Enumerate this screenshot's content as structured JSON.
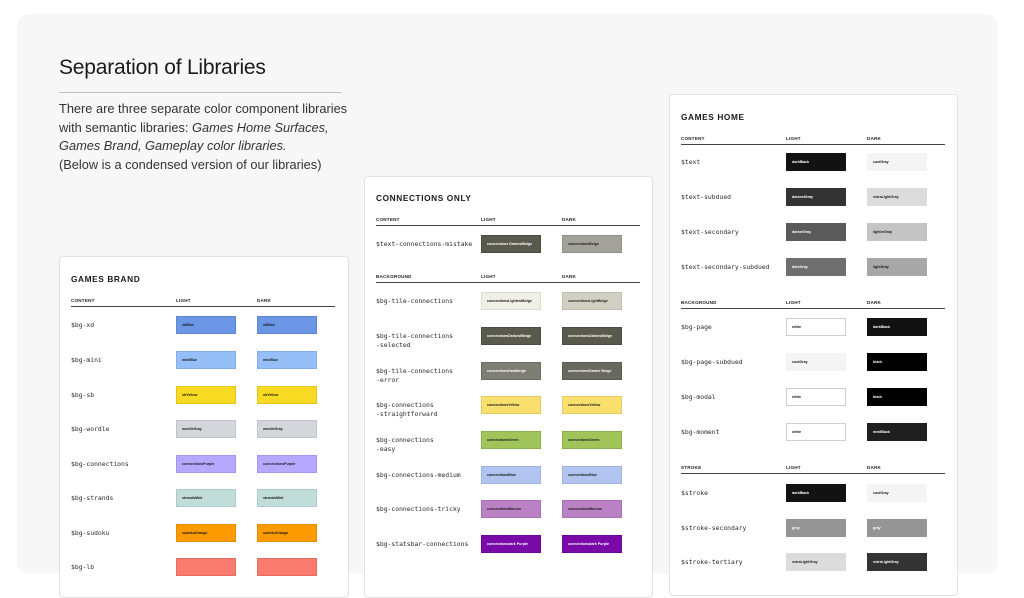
{
  "page": {
    "title": "Separation of Libraries",
    "intro": [
      {
        "segments": [
          {
            "text": "There are three separate color component libraries"
          }
        ]
      },
      {
        "segments": [
          {
            "text": "with semantic libraries: "
          },
          {
            "text": "Games Home Surfaces,",
            "italic": true
          }
        ]
      },
      {
        "segments": [
          {
            "text": "Games Brand, Gameplay color libraries.",
            "italic": true
          }
        ]
      },
      {
        "segments": [
          {
            "text": "(Below is a condensed version of our libraries)"
          }
        ]
      }
    ]
  },
  "cards": [
    {
      "key": "games-brand",
      "title": "GAMES BRAND",
      "sections": [
        {
          "headers": {
            "content": "CONTENT",
            "light": "LIGHT",
            "dark": "DARK"
          },
          "rows": [
            {
              "token": "$bg-xd",
              "light": {
                "label": "xdBlue",
                "bg": "#6b96e5",
                "fg": "#1a1a1a",
                "border": "#5f86d1"
              },
              "dark": {
                "label": "xdBlue",
                "bg": "#6b96e5",
                "fg": "#1a1a1a",
                "border": "#5f86d1"
              }
            },
            {
              "token": "$bg-mini",
              "light": {
                "label": "miniBlue",
                "bg": "#96bff8",
                "fg": "#1a1a1a",
                "border": "#86aee6"
              },
              "dark": {
                "label": "miniBlue",
                "bg": "#96bff8",
                "fg": "#1a1a1a",
                "border": "#86aee6"
              }
            },
            {
              "token": "$bg-sb",
              "light": {
                "label": "sbYellow",
                "bg": "#f7da21",
                "fg": "#1a1a1a",
                "border": "#e0c51c"
              },
              "dark": {
                "label": "sbYellow",
                "bg": "#f7da21",
                "fg": "#1a1a1a",
                "border": "#e0c51c"
              }
            },
            {
              "token": "$bg-wordle",
              "light": {
                "label": "wordleGray",
                "bg": "#d3d6da",
                "fg": "#1a1a1a",
                "border": "#c2c5c9"
              },
              "dark": {
                "label": "wordleGray",
                "bg": "#d3d6da",
                "fg": "#1a1a1a",
                "border": "#c2c5c9"
              }
            },
            {
              "token": "$bg-connections",
              "light": {
                "label": "connectionsPurple",
                "bg": "#b4a8ff",
                "fg": "#1a1a1a",
                "border": "#a397ec"
              },
              "dark": {
                "label": "connectionsPurple",
                "bg": "#b4a8ff",
                "fg": "#1a1a1a",
                "border": "#a397ec"
              }
            },
            {
              "token": "$bg-strands",
              "light": {
                "label": "strandsMint",
                "bg": "#c0ddd9",
                "fg": "#1a1a1a",
                "border": "#aecbc7"
              },
              "dark": {
                "label": "strandsMint",
                "bg": "#c0ddd9",
                "fg": "#1a1a1a",
                "border": "#aecbc7"
              }
            },
            {
              "token": "$bg-sudoku",
              "light": {
                "label": "sudokuOrange",
                "bg": "#fb9b00",
                "fg": "#1a1a1a",
                "border": "#e58d00"
              },
              "dark": {
                "label": "sudokuOrange",
                "bg": "#fb9b00",
                "fg": "#1a1a1a",
                "border": "#e58d00"
              }
            },
            {
              "token": "$bg-lb",
              "light": {
                "label": "",
                "bg": "#f97a6f",
                "fg": "#1a1a1a",
                "border": "#e76c62"
              },
              "dark": {
                "label": "",
                "bg": "#f97a6f",
                "fg": "#1a1a1a",
                "border": "#e76c62"
              }
            }
          ]
        }
      ]
    },
    {
      "key": "connections-only",
      "title": "CONNECTIONS ONLY",
      "sections": [
        {
          "headers": {
            "content": "CONTENT",
            "light": "LIGHT",
            "dark": "DARK"
          },
          "rows": [
            {
              "token": "$text-connections-mistake",
              "light": {
                "label": "connections DarkestBeige",
                "bg": "#5a594e",
                "fg": "#ffffff",
                "border": "#4d4c42"
              },
              "dark": {
                "label": "connectionsBeige",
                "bg": "#a3a29a",
                "fg": "#1a1a1a",
                "border": "#93928a"
              }
            }
          ]
        },
        {
          "headers": {
            "content": "BACKGROUND",
            "light": "LIGHT",
            "dark": "DARK"
          },
          "rows": [
            {
              "token": "$bg-tile-connections",
              "light": {
                "label": "connectionsLightestBeige",
                "bg": "#efefe6",
                "fg": "#1a1a1a",
                "border": "#dcdcd2"
              },
              "dark": {
                "label": "connectionsLightBeige",
                "bg": "#d1d0c3",
                "fg": "#1a1a1a",
                "border": "#c0bfb2"
              }
            },
            {
              "token": "$bg-tile-connections -selected",
              "light": {
                "label": "connectionsDarkestBeige",
                "bg": "#5a594e",
                "fg": "#ffffff",
                "border": "#4d4c42"
              },
              "dark": {
                "label": "connectionsDarkestBeige",
                "bg": "#5a594e",
                "fg": "#ffffff",
                "border": "#4d4c42"
              }
            },
            {
              "token": "$bg-tile-connections -error",
              "light": {
                "label": "connectionsDarkBeige",
                "bg": "#7f7e74",
                "fg": "#ffffff",
                "border": "#6f6e65"
              },
              "dark": {
                "label": "connectionsDarker Beige",
                "bg": "#6a6960",
                "fg": "#ffffff",
                "border": "#5c5b53"
              }
            },
            {
              "token": "$bg-connections -straightforward",
              "light": {
                "label": "connectionsYellow",
                "bg": "#f9df6d",
                "fg": "#1a1a1a",
                "border": "#e6cc5f"
              },
              "dark": {
                "label": "connectionsYellow",
                "bg": "#f9df6d",
                "fg": "#1a1a1a",
                "border": "#e6cc5f"
              }
            },
            {
              "token": "$bg-connections -easy",
              "light": {
                "label": "connectionsGreen",
                "bg": "#a0c35a",
                "fg": "#1a1a1a",
                "border": "#8fb14d"
              },
              "dark": {
                "label": "connectionsGreen",
                "bg": "#a0c35a",
                "fg": "#1a1a1a",
                "border": "#8fb14d"
              }
            },
            {
              "token": "$bg-connections-medium",
              "light": {
                "label": "connectionsBlue",
                "bg": "#b0c4ef",
                "fg": "#1a1a1a",
                "border": "#9fb3de"
              },
              "dark": {
                "label": "connectionsBlue",
                "bg": "#b0c4ef",
                "fg": "#1a1a1a",
                "border": "#9fb3de"
              }
            },
            {
              "token": "$bg-connections-tricky",
              "light": {
                "label": "connectionsMaroon",
                "bg": "#ba81c5",
                "fg": "#1a1a1a",
                "border": "#a972b4"
              },
              "dark": {
                "label": "connectionsMaroon",
                "bg": "#ba81c5",
                "fg": "#1a1a1a",
                "border": "#a972b4"
              }
            },
            {
              "token": "$bg-statsbar-connections",
              "light": {
                "label": "connectionsdark Purple",
                "bg": "#7a0aa8",
                "fg": "#ffffff",
                "border": "#6a0893"
              },
              "dark": {
                "label": "connectionsdark Purple",
                "bg": "#7a0aa8",
                "fg": "#ffffff",
                "border": "#6a0893"
              }
            }
          ]
        }
      ]
    },
    {
      "key": "games-home",
      "title": "GAMES HOME",
      "sections": [
        {
          "headers": {
            "content": "CONTENT",
            "light": "LIGHT",
            "dark": "DARK"
          },
          "rows": [
            {
              "token": "$text",
              "light": {
                "label": "darkBlack",
                "bg": "#121212",
                "fg": "#ffffff",
                "border": "#121212"
              },
              "dark": {
                "label": "coolGray",
                "bg": "#f4f4f4",
                "fg": "#1a1a1a",
                "border": "#f4f4f4"
              }
            },
            {
              "token": "$text-subdued",
              "light": {
                "label": "darkestGray",
                "bg": "#333333",
                "fg": "#ffffff",
                "border": "#333333"
              },
              "dark": {
                "label": "extraLightGray",
                "bg": "#dcdcdc",
                "fg": "#1a1a1a",
                "border": "#dcdcdc"
              }
            },
            {
              "token": "$text-secondary",
              "light": {
                "label": "darkerGray",
                "bg": "#5a5a5a",
                "fg": "#ffffff",
                "border": "#5a5a5a"
              },
              "dark": {
                "label": "lighterGray",
                "bg": "#c4c4c4",
                "fg": "#1a1a1a",
                "border": "#c4c4c4"
              }
            },
            {
              "token": "$text-secondary-subdued",
              "light": {
                "label": "darkGray",
                "bg": "#6f6f6f",
                "fg": "#ffffff",
                "border": "#6f6f6f"
              },
              "dark": {
                "label": "lightGray",
                "bg": "#a7a7a7",
                "fg": "#1a1a1a",
                "border": "#a7a7a7"
              }
            }
          ]
        },
        {
          "headers": {
            "content": "BACKGROUND",
            "light": "LIGHT",
            "dark": "DARK"
          },
          "rows": [
            {
              "token": "$bg-page",
              "light": {
                "label": "white",
                "bg": "#ffffff",
                "fg": "#1a1a1a",
                "border": "#cfcfcf"
              },
              "dark": {
                "label": "darkBlack",
                "bg": "#121212",
                "fg": "#ffffff",
                "border": "#121212"
              }
            },
            {
              "token": "$bg-page-subdued",
              "light": {
                "label": "coolGray",
                "bg": "#f4f4f4",
                "fg": "#1a1a1a",
                "border": "#f4f4f4"
              },
              "dark": {
                "label": "black",
                "bg": "#000000",
                "fg": "#ffffff",
                "border": "#000000"
              }
            },
            {
              "token": "$bg-modal",
              "light": {
                "label": "white",
                "bg": "#ffffff",
                "fg": "#1a1a1a",
                "border": "#cfcfcf"
              },
              "dark": {
                "label": "black",
                "bg": "#000000",
                "fg": "#ffffff",
                "border": "#000000"
              }
            },
            {
              "token": "$bg-moment",
              "light": {
                "label": "white",
                "bg": "#ffffff",
                "fg": "#1a1a1a",
                "border": "#cfcfcf"
              },
              "dark": {
                "label": "medBlack",
                "bg": "#1f1f1f",
                "fg": "#ffffff",
                "border": "#1f1f1f"
              }
            }
          ]
        },
        {
          "headers": {
            "content": "STROKE",
            "light": "LIGHT",
            "dark": "DARK"
          },
          "rows": [
            {
              "token": "$stroke",
              "light": {
                "label": "darkBlack",
                "bg": "#121212",
                "fg": "#ffffff",
                "border": "#121212"
              },
              "dark": {
                "label": "coolGray",
                "bg": "#f4f4f4",
                "fg": "#1a1a1a",
                "border": "#f4f4f4"
              }
            },
            {
              "token": "$stroke-secondary",
              "light": {
                "label": "gray",
                "bg": "#959595",
                "fg": "#ffffff",
                "border": "#959595"
              },
              "dark": {
                "label": "gray",
                "bg": "#959595",
                "fg": "#ffffff",
                "border": "#959595"
              }
            },
            {
              "token": "$stroke-tertiary",
              "light": {
                "label": "extraLightGray",
                "bg": "#dcdcdc",
                "fg": "#1a1a1a",
                "border": "#dcdcdc"
              },
              "dark": {
                "label": "extraLightGray",
                "bg": "#333333",
                "fg": "#ffffff",
                "border": "#333333"
              }
            }
          ]
        }
      ]
    }
  ]
}
